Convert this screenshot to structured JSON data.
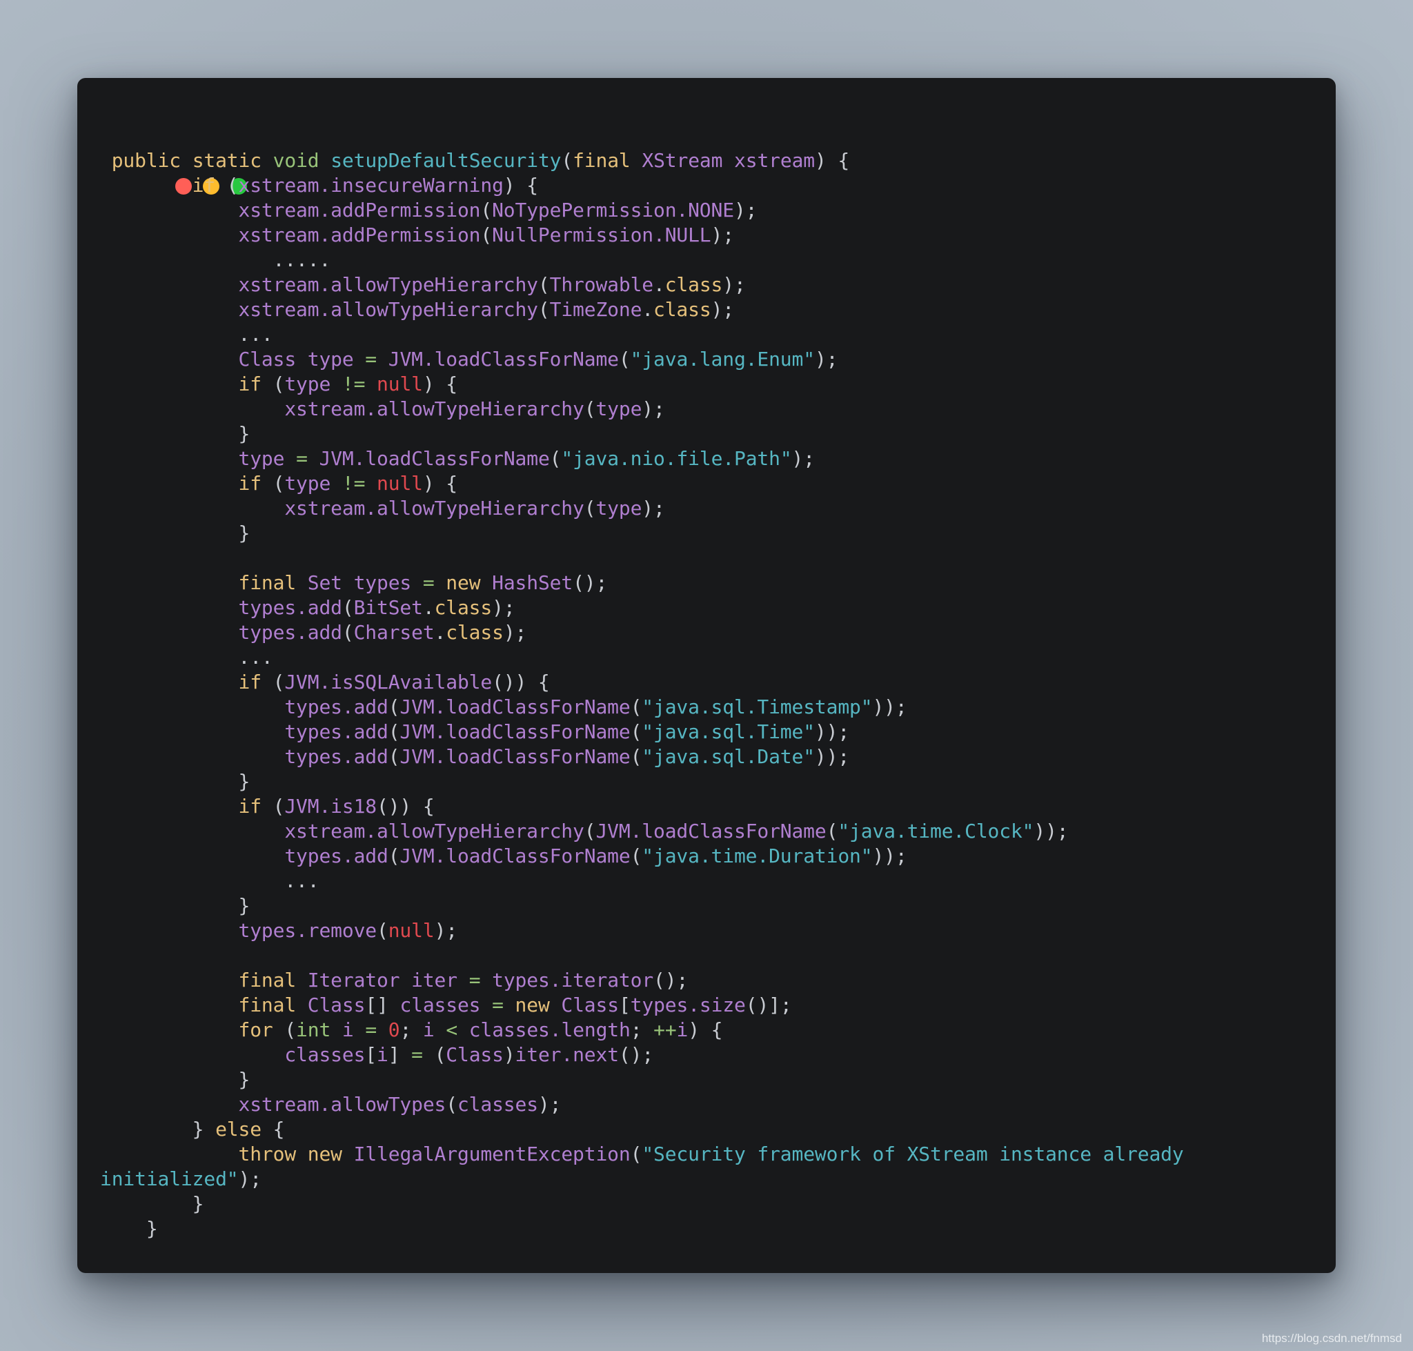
{
  "window": {
    "controls": [
      {
        "name": "close",
        "color": "#ff5f57"
      },
      {
        "name": "minimize",
        "color": "#febc2e"
      },
      {
        "name": "maximize",
        "color": "#28c840"
      }
    ]
  },
  "code": {
    "language": "java",
    "lines": [
      [
        [
          " ",
          "pu"
        ],
        [
          "public",
          "kw"
        ],
        [
          " ",
          "pu"
        ],
        [
          "static",
          "kw"
        ],
        [
          " ",
          "pu"
        ],
        [
          "void",
          "ty"
        ],
        [
          " ",
          "pu"
        ],
        [
          "setupDefaultSecurity",
          "fn"
        ],
        [
          "(",
          "pu"
        ],
        [
          "final",
          "kw"
        ],
        [
          " ",
          "pu"
        ],
        [
          "XStream",
          "id"
        ],
        [
          " ",
          "pu"
        ],
        [
          "xstream",
          "id"
        ],
        [
          ") {",
          "pu"
        ]
      ],
      [
        [
          "        ",
          "pu"
        ],
        [
          "if",
          "kw"
        ],
        [
          " (",
          "pu"
        ],
        [
          "xstream.insecureWarning",
          "id"
        ],
        [
          ") {",
          "pu"
        ]
      ],
      [
        [
          "            ",
          "pu"
        ],
        [
          "xstream.addPermission",
          "id"
        ],
        [
          "(",
          "pu"
        ],
        [
          "NoTypePermission.NONE",
          "id"
        ],
        [
          ");",
          "pu"
        ]
      ],
      [
        [
          "            ",
          "pu"
        ],
        [
          "xstream.addPermission",
          "id"
        ],
        [
          "(",
          "pu"
        ],
        [
          "NullPermission.NULL",
          "id"
        ],
        [
          ");",
          "pu"
        ]
      ],
      [
        [
          "               .....",
          "pu"
        ]
      ],
      [
        [
          "            ",
          "pu"
        ],
        [
          "xstream.allowTypeHierarchy",
          "id"
        ],
        [
          "(",
          "pu"
        ],
        [
          "Throwable",
          "id"
        ],
        [
          ".",
          "pu"
        ],
        [
          "class",
          "kw"
        ],
        [
          ");",
          "pu"
        ]
      ],
      [
        [
          "            ",
          "pu"
        ],
        [
          "xstream.allowTypeHierarchy",
          "id"
        ],
        [
          "(",
          "pu"
        ],
        [
          "TimeZone",
          "id"
        ],
        [
          ".",
          "pu"
        ],
        [
          "class",
          "kw"
        ],
        [
          ");",
          "pu"
        ]
      ],
      [
        [
          "            ...",
          "pu"
        ]
      ],
      [
        [
          "            ",
          "pu"
        ],
        [
          "Class type",
          "id"
        ],
        [
          " ",
          "pu"
        ],
        [
          "=",
          "op"
        ],
        [
          " ",
          "pu"
        ],
        [
          "JVM.loadClassForName",
          "id"
        ],
        [
          "(",
          "pu"
        ],
        [
          "\"java.lang.Enum\"",
          "st"
        ],
        [
          ");",
          "pu"
        ]
      ],
      [
        [
          "            ",
          "pu"
        ],
        [
          "if",
          "kw"
        ],
        [
          " (",
          "pu"
        ],
        [
          "type",
          "id"
        ],
        [
          " ",
          "pu"
        ],
        [
          "!=",
          "op"
        ],
        [
          " ",
          "pu"
        ],
        [
          "null",
          "nu"
        ],
        [
          ") {",
          "pu"
        ]
      ],
      [
        [
          "                ",
          "pu"
        ],
        [
          "xstream.allowTypeHierarchy",
          "id"
        ],
        [
          "(",
          "pu"
        ],
        [
          "type",
          "id"
        ],
        [
          ");",
          "pu"
        ]
      ],
      [
        [
          "            }",
          "pu"
        ]
      ],
      [
        [
          "            ",
          "pu"
        ],
        [
          "type",
          "id"
        ],
        [
          " ",
          "pu"
        ],
        [
          "=",
          "op"
        ],
        [
          " ",
          "pu"
        ],
        [
          "JVM.loadClassForName",
          "id"
        ],
        [
          "(",
          "pu"
        ],
        [
          "\"java.nio.file.Path\"",
          "st"
        ],
        [
          ");",
          "pu"
        ]
      ],
      [
        [
          "            ",
          "pu"
        ],
        [
          "if",
          "kw"
        ],
        [
          " (",
          "pu"
        ],
        [
          "type",
          "id"
        ],
        [
          " ",
          "pu"
        ],
        [
          "!=",
          "op"
        ],
        [
          " ",
          "pu"
        ],
        [
          "null",
          "nu"
        ],
        [
          ") {",
          "pu"
        ]
      ],
      [
        [
          "                ",
          "pu"
        ],
        [
          "xstream.allowTypeHierarchy",
          "id"
        ],
        [
          "(",
          "pu"
        ],
        [
          "type",
          "id"
        ],
        [
          ");",
          "pu"
        ]
      ],
      [
        [
          "            }",
          "pu"
        ]
      ],
      [
        [
          "",
          "pu"
        ]
      ],
      [
        [
          "            ",
          "pu"
        ],
        [
          "final",
          "kw"
        ],
        [
          " ",
          "pu"
        ],
        [
          "Set types",
          "id"
        ],
        [
          " ",
          "pu"
        ],
        [
          "=",
          "op"
        ],
        [
          " ",
          "pu"
        ],
        [
          "new",
          "kw"
        ],
        [
          " ",
          "pu"
        ],
        [
          "HashSet",
          "id"
        ],
        [
          "();",
          "pu"
        ]
      ],
      [
        [
          "            ",
          "pu"
        ],
        [
          "types.add",
          "id"
        ],
        [
          "(",
          "pu"
        ],
        [
          "BitSet",
          "id"
        ],
        [
          ".",
          "pu"
        ],
        [
          "class",
          "kw"
        ],
        [
          ");",
          "pu"
        ]
      ],
      [
        [
          "            ",
          "pu"
        ],
        [
          "types.add",
          "id"
        ],
        [
          "(",
          "pu"
        ],
        [
          "Charset",
          "id"
        ],
        [
          ".",
          "pu"
        ],
        [
          "class",
          "kw"
        ],
        [
          ");",
          "pu"
        ]
      ],
      [
        [
          "            ...",
          "pu"
        ]
      ],
      [
        [
          "            ",
          "pu"
        ],
        [
          "if",
          "kw"
        ],
        [
          " (",
          "pu"
        ],
        [
          "JVM.isSQLAvailable",
          "id"
        ],
        [
          "()) {",
          "pu"
        ]
      ],
      [
        [
          "                ",
          "pu"
        ],
        [
          "types.add",
          "id"
        ],
        [
          "(",
          "pu"
        ],
        [
          "JVM.loadClassForName",
          "id"
        ],
        [
          "(",
          "pu"
        ],
        [
          "\"java.sql.Timestamp\"",
          "st"
        ],
        [
          "));",
          "pu"
        ]
      ],
      [
        [
          "                ",
          "pu"
        ],
        [
          "types.add",
          "id"
        ],
        [
          "(",
          "pu"
        ],
        [
          "JVM.loadClassForName",
          "id"
        ],
        [
          "(",
          "pu"
        ],
        [
          "\"java.sql.Time\"",
          "st"
        ],
        [
          "));",
          "pu"
        ]
      ],
      [
        [
          "                ",
          "pu"
        ],
        [
          "types.add",
          "id"
        ],
        [
          "(",
          "pu"
        ],
        [
          "JVM.loadClassForName",
          "id"
        ],
        [
          "(",
          "pu"
        ],
        [
          "\"java.sql.Date\"",
          "st"
        ],
        [
          "));",
          "pu"
        ]
      ],
      [
        [
          "            }",
          "pu"
        ]
      ],
      [
        [
          "            ",
          "pu"
        ],
        [
          "if",
          "kw"
        ],
        [
          " (",
          "pu"
        ],
        [
          "JVM.is18",
          "id"
        ],
        [
          "()) {",
          "pu"
        ]
      ],
      [
        [
          "                ",
          "pu"
        ],
        [
          "xstream.allowTypeHierarchy",
          "id"
        ],
        [
          "(",
          "pu"
        ],
        [
          "JVM.loadClassForName",
          "id"
        ],
        [
          "(",
          "pu"
        ],
        [
          "\"java.time.Clock\"",
          "st"
        ],
        [
          "));",
          "pu"
        ]
      ],
      [
        [
          "                ",
          "pu"
        ],
        [
          "types.add",
          "id"
        ],
        [
          "(",
          "pu"
        ],
        [
          "JVM.loadClassForName",
          "id"
        ],
        [
          "(",
          "pu"
        ],
        [
          "\"java.time.Duration\"",
          "st"
        ],
        [
          "));",
          "pu"
        ]
      ],
      [
        [
          "                ...",
          "pu"
        ]
      ],
      [
        [
          "            }",
          "pu"
        ]
      ],
      [
        [
          "            ",
          "pu"
        ],
        [
          "types.remove",
          "id"
        ],
        [
          "(",
          "pu"
        ],
        [
          "null",
          "nu"
        ],
        [
          ");",
          "pu"
        ]
      ],
      [
        [
          "",
          "pu"
        ]
      ],
      [
        [
          "            ",
          "pu"
        ],
        [
          "final",
          "kw"
        ],
        [
          " ",
          "pu"
        ],
        [
          "Iterator iter",
          "id"
        ],
        [
          " ",
          "pu"
        ],
        [
          "=",
          "op"
        ],
        [
          " ",
          "pu"
        ],
        [
          "types.iterator",
          "id"
        ],
        [
          "();",
          "pu"
        ]
      ],
      [
        [
          "            ",
          "pu"
        ],
        [
          "final",
          "kw"
        ],
        [
          " ",
          "pu"
        ],
        [
          "Class",
          "id"
        ],
        [
          "[] ",
          "pu"
        ],
        [
          "classes",
          "id"
        ],
        [
          " ",
          "pu"
        ],
        [
          "=",
          "op"
        ],
        [
          " ",
          "pu"
        ],
        [
          "new",
          "kw"
        ],
        [
          " ",
          "pu"
        ],
        [
          "Class",
          "id"
        ],
        [
          "[",
          "pu"
        ],
        [
          "types.size",
          "id"
        ],
        [
          "()];",
          "pu"
        ]
      ],
      [
        [
          "            ",
          "pu"
        ],
        [
          "for",
          "kw"
        ],
        [
          " (",
          "pu"
        ],
        [
          "int",
          "ty"
        ],
        [
          " ",
          "pu"
        ],
        [
          "i",
          "id"
        ],
        [
          " ",
          "pu"
        ],
        [
          "=",
          "op"
        ],
        [
          " ",
          "pu"
        ],
        [
          "0",
          "nu"
        ],
        [
          "; ",
          "pu"
        ],
        [
          "i",
          "id"
        ],
        [
          " ",
          "pu"
        ],
        [
          "<",
          "op"
        ],
        [
          " ",
          "pu"
        ],
        [
          "classes.length",
          "id"
        ],
        [
          "; ",
          "pu"
        ],
        [
          "++",
          "op"
        ],
        [
          "i",
          "id"
        ],
        [
          ") {",
          "pu"
        ]
      ],
      [
        [
          "                ",
          "pu"
        ],
        [
          "classes",
          "id"
        ],
        [
          "[",
          "pu"
        ],
        [
          "i",
          "id"
        ],
        [
          "] ",
          "pu"
        ],
        [
          "=",
          "op"
        ],
        [
          " (",
          "pu"
        ],
        [
          "Class",
          "id"
        ],
        [
          ")",
          "pu"
        ],
        [
          "iter.next",
          "id"
        ],
        [
          "();",
          "pu"
        ]
      ],
      [
        [
          "            }",
          "pu"
        ]
      ],
      [
        [
          "            ",
          "pu"
        ],
        [
          "xstream.allowTypes",
          "id"
        ],
        [
          "(",
          "pu"
        ],
        [
          "classes",
          "id"
        ],
        [
          ");",
          "pu"
        ]
      ],
      [
        [
          "        } ",
          "pu"
        ],
        [
          "else",
          "kw"
        ],
        [
          " {",
          "pu"
        ]
      ],
      [
        [
          "            ",
          "pu"
        ],
        [
          "throw",
          "kw"
        ],
        [
          " ",
          "pu"
        ],
        [
          "new",
          "kw"
        ],
        [
          " ",
          "pu"
        ],
        [
          "IllegalArgumentException",
          "id"
        ],
        [
          "(",
          "pu"
        ],
        [
          "\"Security framework of XStream instance already",
          "st"
        ]
      ],
      [
        [
          "initialized\"",
          "st"
        ],
        [
          ");",
          "pu"
        ]
      ],
      [
        [
          "        }",
          "pu"
        ]
      ],
      [
        [
          "    }",
          "pu"
        ]
      ]
    ]
  },
  "watermark": "https://blog.csdn.net/fnmsd"
}
